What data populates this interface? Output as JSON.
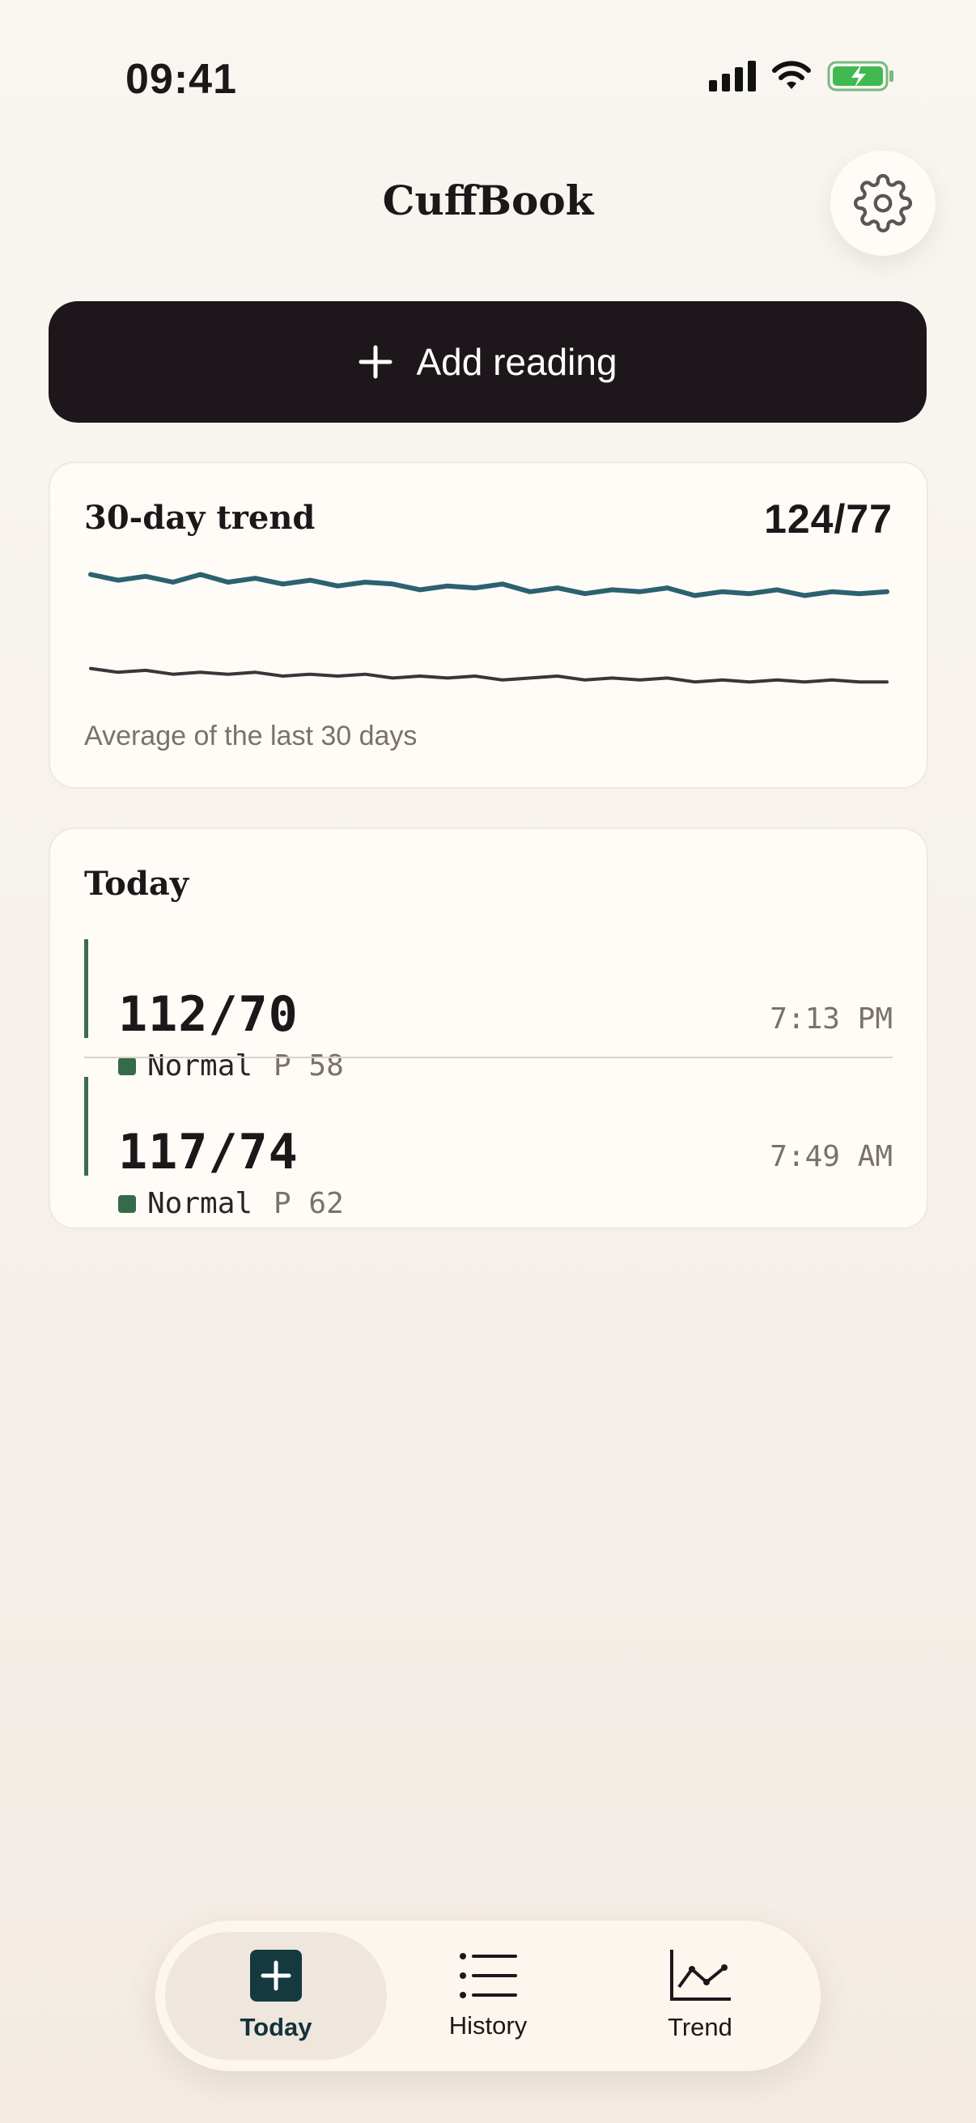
{
  "status_bar": {
    "time": "09:41"
  },
  "header": {
    "title": "CuffBook",
    "settings_icon": "gear-icon"
  },
  "add_button": {
    "label": "Add reading",
    "icon": "plus-icon"
  },
  "trend_card": {
    "title": "30-day trend",
    "average": "124/77",
    "subtitle": "Average of the last 30 days",
    "colors": {
      "systolic": "#2c6170",
      "diastolic": "#3b3438"
    }
  },
  "chart_data": {
    "type": "line",
    "x": [
      1,
      2,
      3,
      4,
      5,
      6,
      7,
      8,
      9,
      10,
      11,
      12,
      13,
      14,
      15,
      16,
      17,
      18,
      19,
      20,
      21,
      22,
      23,
      24,
      25,
      26,
      27,
      28,
      29,
      30
    ],
    "series": [
      {
        "values": [
          131,
          128,
          130,
          127,
          131,
          127,
          129,
          126,
          128,
          125,
          127,
          126,
          123,
          125,
          124,
          126,
          122,
          124,
          121,
          123,
          122,
          124,
          120,
          122,
          121,
          123,
          120,
          122,
          121,
          122
        ]
      },
      {
        "values": [
          82,
          80,
          81,
          79,
          80,
          79,
          80,
          78,
          79,
          78,
          79,
          77,
          78,
          77,
          78,
          76,
          77,
          78,
          76,
          77,
          76,
          77,
          75,
          76,
          75,
          76,
          75,
          76,
          75,
          75
        ]
      }
    ],
    "ylim": [
      70,
      135
    ]
  },
  "today": {
    "title": "Today",
    "readings": [
      {
        "value": "112/70",
        "time": "7:13 PM",
        "status": "Normal",
        "pulse": "P 58"
      },
      {
        "value": "117/74",
        "time": "7:49 AM",
        "status": "Normal",
        "pulse": "P 62"
      }
    ]
  },
  "tabs": [
    {
      "label": "Today",
      "icon": "plus-square-icon",
      "active": true
    },
    {
      "label": "History",
      "icon": "list-icon",
      "active": false
    },
    {
      "label": "Trend",
      "icon": "chart-line-icon",
      "active": false
    }
  ]
}
